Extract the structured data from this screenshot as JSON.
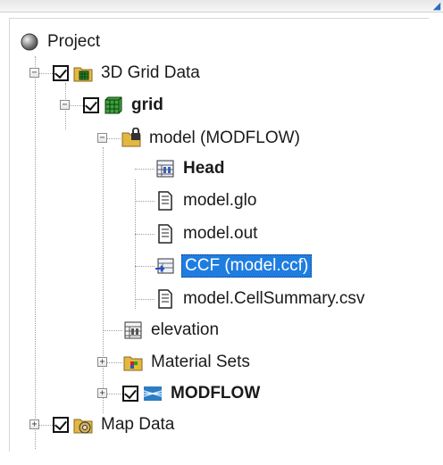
{
  "tree": {
    "project": {
      "label": "Project",
      "icon": "project-circle-icon"
    },
    "grid_data": {
      "label": "3D Grid Data",
      "icon": "3d-grid-folder-icon",
      "checked": true
    },
    "grid": {
      "label": "grid",
      "icon": "green-grid-icon",
      "checked": true
    },
    "model": {
      "label": "model (MODFLOW)",
      "icon": "locked-folder-icon"
    },
    "head": {
      "label": "Head",
      "icon": "dataset-icon"
    },
    "model_glo": {
      "label": "model.glo",
      "icon": "text-file-icon"
    },
    "model_out": {
      "label": "model.out",
      "icon": "text-file-icon"
    },
    "ccf": {
      "label": "CCF (model.ccf)",
      "icon": "ccf-file-icon",
      "selected": true
    },
    "cell_summary": {
      "label": "model.CellSummary.csv",
      "icon": "text-file-icon"
    },
    "elevation": {
      "label": "elevation",
      "icon": "dataset-icon"
    },
    "material_sets": {
      "label": "Material Sets",
      "icon": "material-folder-icon"
    },
    "modflow": {
      "label": "MODFLOW",
      "icon": "modflow-icon",
      "checked": true
    },
    "map_data": {
      "label": "Map Data",
      "icon": "map-folder-icon",
      "checked": true
    }
  },
  "colors": {
    "selection": "#1f7de0",
    "text": "#1a1a1a",
    "grid_green": "#2f8b2f",
    "folder_yellow": "#e4b743"
  }
}
